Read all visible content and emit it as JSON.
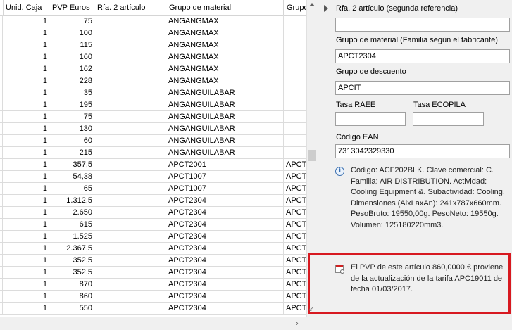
{
  "grid": {
    "columns": [
      "Unid. Caja",
      "PVP Euros",
      "Rfa. 2 artículo",
      "Grupo de material",
      "Grupo"
    ],
    "rows": [
      {
        "unid": "1",
        "pvp": "75",
        "rfa": "",
        "grupo": "ANGANGMAX",
        "grupo2": ""
      },
      {
        "unid": "1",
        "pvp": "100",
        "rfa": "",
        "grupo": "ANGANGMAX",
        "grupo2": ""
      },
      {
        "unid": "1",
        "pvp": "115",
        "rfa": "",
        "grupo": "ANGANGMAX",
        "grupo2": ""
      },
      {
        "unid": "1",
        "pvp": "160",
        "rfa": "",
        "grupo": "ANGANGMAX",
        "grupo2": ""
      },
      {
        "unid": "1",
        "pvp": "162",
        "rfa": "",
        "grupo": "ANGANGMAX",
        "grupo2": ""
      },
      {
        "unid": "1",
        "pvp": "228",
        "rfa": "",
        "grupo": "ANGANGMAX",
        "grupo2": ""
      },
      {
        "unid": "1",
        "pvp": "35",
        "rfa": "",
        "grupo": "ANGANGUILABAR",
        "grupo2": ""
      },
      {
        "unid": "1",
        "pvp": "195",
        "rfa": "",
        "grupo": "ANGANGUILABAR",
        "grupo2": ""
      },
      {
        "unid": "1",
        "pvp": "75",
        "rfa": "",
        "grupo": "ANGANGUILABAR",
        "grupo2": ""
      },
      {
        "unid": "1",
        "pvp": "130",
        "rfa": "",
        "grupo": "ANGANGUILABAR",
        "grupo2": ""
      },
      {
        "unid": "1",
        "pvp": "60",
        "rfa": "",
        "grupo": "ANGANGUILABAR",
        "grupo2": ""
      },
      {
        "unid": "1",
        "pvp": "215",
        "rfa": "",
        "grupo": "ANGANGUILABAR",
        "grupo2": ""
      },
      {
        "unid": "1",
        "pvp": "357,5",
        "rfa": "",
        "grupo": "APCT2001",
        "grupo2": "APCT"
      },
      {
        "unid": "1",
        "pvp": "54,38",
        "rfa": "",
        "grupo": "APCT1007",
        "grupo2": "APCT"
      },
      {
        "unid": "1",
        "pvp": "65",
        "rfa": "",
        "grupo": "APCT1007",
        "grupo2": "APCT"
      },
      {
        "unid": "1",
        "pvp": "1.312,5",
        "rfa": "",
        "grupo": "APCT2304",
        "grupo2": "APCT"
      },
      {
        "unid": "1",
        "pvp": "2.650",
        "rfa": "",
        "grupo": "APCT2304",
        "grupo2": "APCT"
      },
      {
        "unid": "1",
        "pvp": "615",
        "rfa": "",
        "grupo": "APCT2304",
        "grupo2": "APCT"
      },
      {
        "unid": "1",
        "pvp": "1.525",
        "rfa": "",
        "grupo": "APCT2304",
        "grupo2": "APCT"
      },
      {
        "unid": "1",
        "pvp": "2.367,5",
        "rfa": "",
        "grupo": "APCT2304",
        "grupo2": "APCT"
      },
      {
        "unid": "1",
        "pvp": "352,5",
        "rfa": "",
        "grupo": "APCT2304",
        "grupo2": "APCT"
      },
      {
        "unid": "1",
        "pvp": "352,5",
        "rfa": "",
        "grupo": "APCT2304",
        "grupo2": "APCT"
      },
      {
        "unid": "1",
        "pvp": "870",
        "rfa": "",
        "grupo": "APCT2304",
        "grupo2": "APCT"
      },
      {
        "unid": "1",
        "pvp": "860",
        "rfa": "",
        "grupo": "APCT2304",
        "grupo2": "APCT"
      },
      {
        "unid": "1",
        "pvp": "550",
        "rfa": "",
        "grupo": "APCT2304",
        "grupo2": "APCT"
      }
    ]
  },
  "panel": {
    "rfa2_label": "Rfa. 2 artículo (segunda referencia)",
    "rfa2_value": "",
    "grupo_material_label": "Grupo de material (Familia según el fabricante)",
    "grupo_material_value": "APCT2304",
    "grupo_descuento_label": "Grupo de descuento",
    "grupo_descuento_value": "APCIT",
    "tasa_raee_label": "Tasa RAEE",
    "tasa_raee_value": "",
    "tasa_ecopila_label": "Tasa ECOPILA",
    "tasa_ecopila_value": "",
    "ean_label": "Código EAN",
    "ean_value": "7313042329330",
    "info_text": "Código: ACF202BLK. Clave comercial: C. Familia: AIR DISTRIBUTION. Actividad: Cooling Equipment &. Subactividad: Cooling. Dimensiones (AlxLaxAn): 241x787x660mm. PesoBruto: 19550,00g. PesoNeto: 19550g. Volumen: 125180220mm3.",
    "price_text": "El PVP de este artículo 860,0000 € proviene de la actualización de la tarifa APC19011 de fecha 01/03/2017."
  },
  "icons": {
    "info": "info-icon",
    "calendar": "calendar-clock-icon",
    "expand": "expand-triangle-icon"
  },
  "colors": {
    "highlight": "#d71920",
    "grid_line": "#dcdcdc",
    "panel_bg": "#f0f0f0"
  }
}
